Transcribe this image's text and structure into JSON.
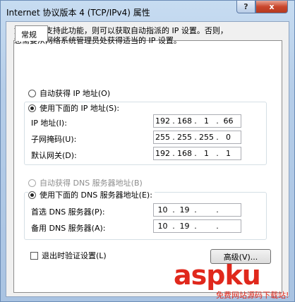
{
  "window": {
    "title": "Internet 协议版本 4 (TCP/IPv4) 属性",
    "help": "?",
    "close": "x"
  },
  "tab": "常规",
  "description": [
    "如果网络支持此功能，则可以获取自动指派的 IP 设置。否则，",
    "您需要从网络系统管理员处获得适当的 IP 设置。"
  ],
  "ip": {
    "auto_label": "自动获得 IP 地址(O)",
    "manual_label": "使用下面的 IP 地址(S):",
    "fields": [
      {
        "label": "IP 地址(I):",
        "octets": [
          "192",
          "168",
          "1",
          "66"
        ]
      },
      {
        "label": "子网掩码(U):",
        "octets": [
          "255",
          "255",
          "255",
          "0"
        ]
      },
      {
        "label": "默认网关(D):",
        "octets": [
          "192",
          "168",
          "1",
          "1"
        ]
      }
    ]
  },
  "dns": {
    "auto_label": "自动获得 DNS 服务器地址(B)",
    "manual_label": "使用下面的 DNS 服务器地址(E):",
    "fields": [
      {
        "label": "首选 DNS 服务器(P):",
        "octets": [
          "10",
          "19",
          "",
          ""
        ]
      },
      {
        "label": "备用 DNS 服务器(A):",
        "octets": [
          "10",
          "19",
          "",
          ""
        ]
      }
    ]
  },
  "validate_label": "退出时验证设置(L)",
  "advanced_button": "高级(V)...",
  "watermark": {
    "main": "aspku",
    "sub": "免费网站源码下载站!"
  }
}
